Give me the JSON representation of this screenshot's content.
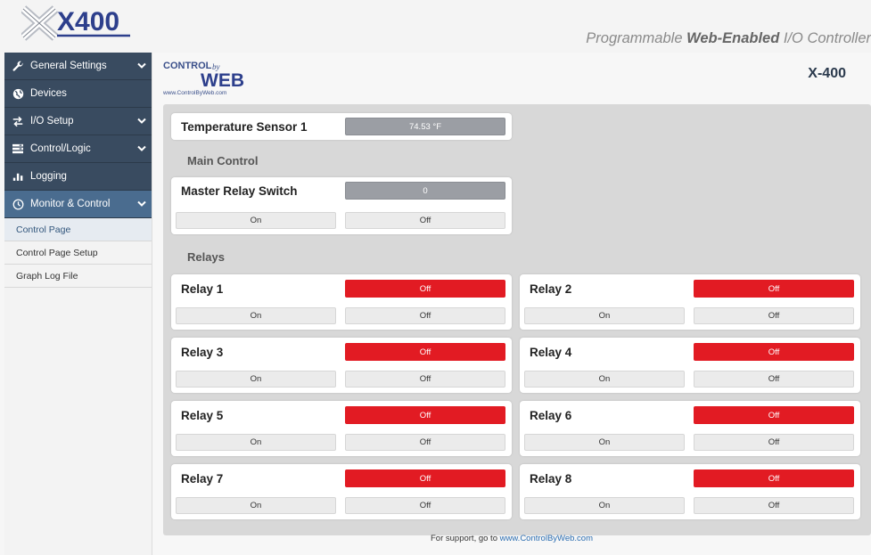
{
  "header": {
    "logo_text": "X400",
    "tagline_prefix": "Programmable ",
    "tagline_bold": "Web-Enabled",
    "tagline_suffix": " I/O Controller"
  },
  "sidebar": {
    "items": [
      {
        "label": "General Settings",
        "icon": "wrench-icon",
        "chevron": true
      },
      {
        "label": "Devices",
        "icon": "globe-icon",
        "chevron": false
      },
      {
        "label": "I/O Setup",
        "icon": "arrows-icon",
        "chevron": true
      },
      {
        "label": "Control/Logic",
        "icon": "control-logic-icon",
        "chevron": true
      },
      {
        "label": "Logging",
        "icon": "chart-icon",
        "chevron": false
      },
      {
        "label": "Monitor & Control",
        "icon": "clock-icon",
        "chevron": true
      }
    ],
    "subitems": [
      "Control Page",
      "Control Page Setup",
      "Graph Log File"
    ]
  },
  "brand": {
    "line1": "CONTROL",
    "by": "by",
    "line2": "WEB",
    "url": "www.ControlByWeb.com"
  },
  "model": "X-400",
  "temperature": {
    "label": "Temperature Sensor 1",
    "value": "74.53 °F"
  },
  "main_control": {
    "section": "Main Control",
    "label": "Master Relay Switch",
    "value": "0",
    "on_label": "On",
    "off_label": "Off"
  },
  "relays_section": "Relays",
  "relays": [
    {
      "label": "Relay 1",
      "state": "Off",
      "on_label": "On",
      "off_label": "Off"
    },
    {
      "label": "Relay 2",
      "state": "Off",
      "on_label": "On",
      "off_label": "Off"
    },
    {
      "label": "Relay 3",
      "state": "Off",
      "on_label": "On",
      "off_label": "Off"
    },
    {
      "label": "Relay 4",
      "state": "Off",
      "on_label": "On",
      "off_label": "Off"
    },
    {
      "label": "Relay 5",
      "state": "Off",
      "on_label": "On",
      "off_label": "Off"
    },
    {
      "label": "Relay 6",
      "state": "Off",
      "on_label": "On",
      "off_label": "Off"
    },
    {
      "label": "Relay 7",
      "state": "Off",
      "on_label": "On",
      "off_label": "Off"
    },
    {
      "label": "Relay 8",
      "state": "Off",
      "on_label": "On",
      "off_label": "Off"
    }
  ],
  "footer": {
    "text": "For support, go to ",
    "link": "www.ControlByWeb.com"
  },
  "colors": {
    "sidebar": "#394b60",
    "sidebar_active": "#4a6c8f",
    "relay_off": "#e21b23",
    "status_grey": "#9b9ea4"
  }
}
